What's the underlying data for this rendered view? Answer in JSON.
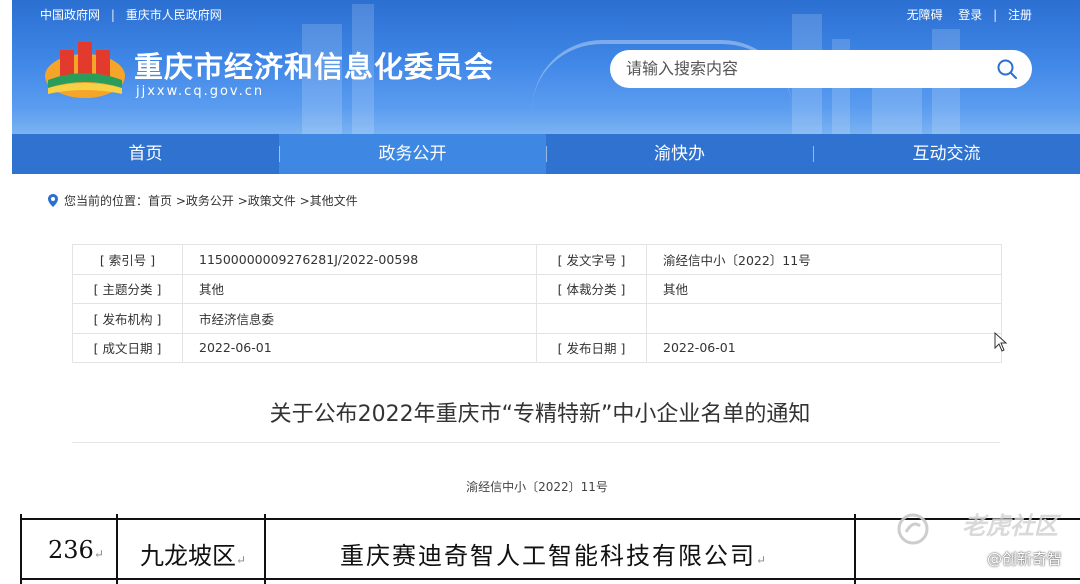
{
  "header": {
    "top_left_links": [
      "中国政府网",
      "重庆市人民政府网"
    ],
    "top_right_links": [
      "无障碍",
      "登录",
      "注册"
    ],
    "site_title": "重庆市经济和信息化委员会",
    "site_domain": "jjxxw.cq.gov.cn",
    "search_placeholder": "请输入搜索内容"
  },
  "nav": {
    "items": [
      {
        "label": "首页"
      },
      {
        "label": "政务公开"
      },
      {
        "label": "渝快办"
      },
      {
        "label": "互动交流"
      }
    ]
  },
  "breadcrumb": {
    "prefix": "您当前的位置：",
    "path": "首页 >政务公开 >政策文件 >其他文件"
  },
  "info": {
    "rows": [
      {
        "l1": "[ 索引号 ]",
        "v1": "11500000009276281J/2022-00598",
        "l2": "[ 发文字号 ]",
        "v2": "渝经信中小〔2022〕11号"
      },
      {
        "l1": "[ 主题分类 ]",
        "v1": "其他",
        "l2": "[ 体裁分类 ]",
        "v2": "其他"
      },
      {
        "l1": "[ 发布机构 ]",
        "v1": "市经济信息委",
        "l2": "",
        "v2": ""
      },
      {
        "l1": "[ 成文日期 ]",
        "v1": "2022-06-01",
        "l2": "[ 发布日期 ]",
        "v2": "2022-06-01"
      }
    ]
  },
  "document": {
    "title": "关于公布2022年重庆市“专精特新”中小企业名单的通知",
    "number": "渝经信中小〔2022〕11号"
  },
  "table_row": {
    "index": "236",
    "district": "九龙坡区",
    "company": "重庆赛迪奇智人工智能科技有限公司",
    "return_mark": "↵"
  },
  "watermark": {
    "main": "老虎社区",
    "sub": "@创新奇智"
  },
  "colors": {
    "header_blue": "#2b6fd1",
    "nav_blue": "#2f72d0",
    "nav_active": "#3e87e2"
  }
}
